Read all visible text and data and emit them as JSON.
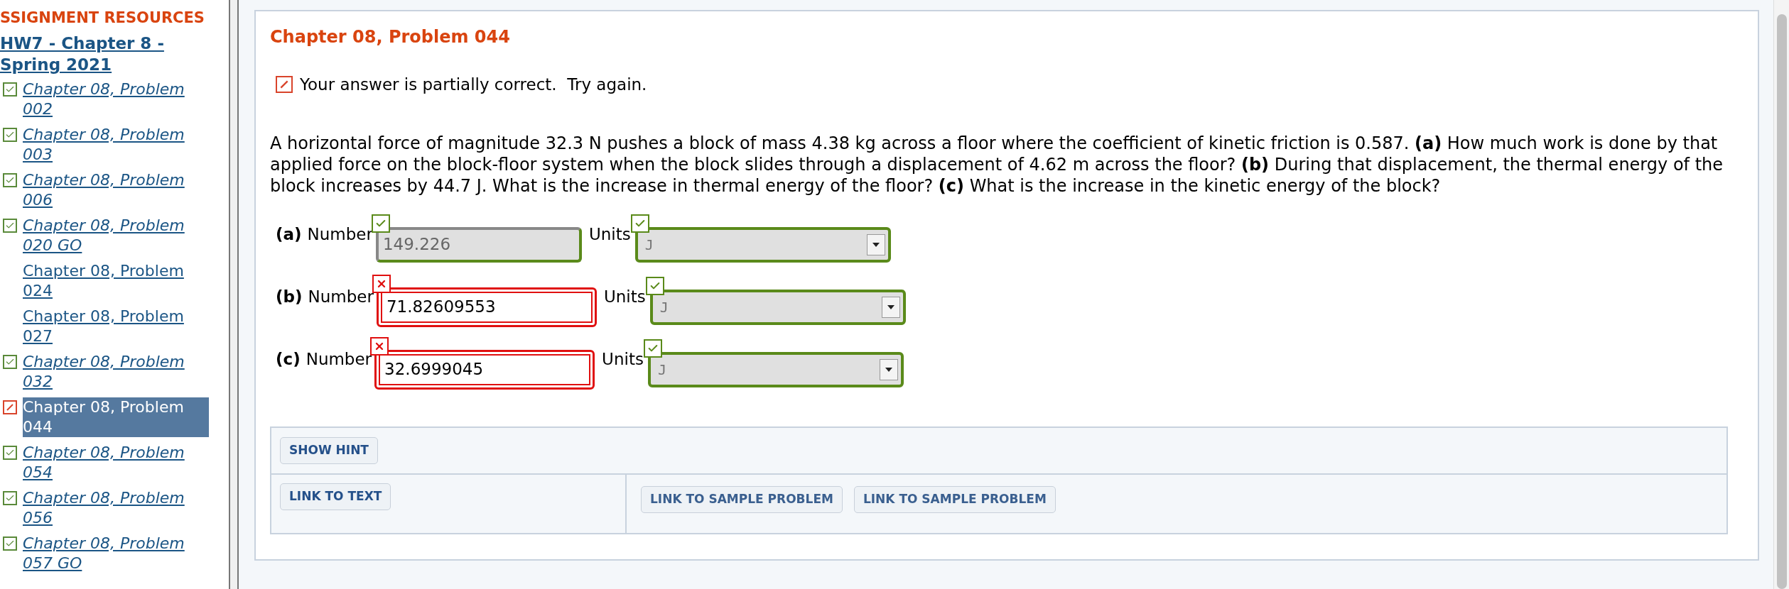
{
  "sidebar": {
    "heading": "SSIGNMENT RESOURCES",
    "assignment": "HW7 - Chapter 8 - Spring 2021",
    "items": [
      {
        "label": "Chapter 08, Problem 002",
        "kind": "correct",
        "selected": false
      },
      {
        "label": "Chapter 08, Problem 003",
        "kind": "correct",
        "selected": false
      },
      {
        "label": "Chapter 08, Problem 006",
        "kind": "correct",
        "selected": false
      },
      {
        "label": "Chapter 08, Problem 020 GO",
        "kind": "correct",
        "selected": false
      },
      {
        "label": "Chapter 08, Problem 024",
        "kind": "none",
        "selected": false
      },
      {
        "label": "Chapter 08, Problem 027",
        "kind": "none",
        "selected": false
      },
      {
        "label": "Chapter 08, Problem 032",
        "kind": "correct",
        "selected": false
      },
      {
        "label": "Chapter 08, Problem 044",
        "kind": "partial",
        "selected": true
      },
      {
        "label": "Chapter 08, Problem 054",
        "kind": "correct",
        "selected": false
      },
      {
        "label": "Chapter 08, Problem 056",
        "kind": "correct",
        "selected": false
      },
      {
        "label": "Chapter 08, Problem 057 GO",
        "kind": "correct",
        "selected": false
      }
    ]
  },
  "problem": {
    "title": "Chapter 08, Problem 044",
    "feedback": "Your answer is partially correct.  Try again.",
    "text": "A horizontal force of magnitude 32.3 N pushes a block of mass 4.38 kg across a floor where the coefficient of kinetic friction is 0.587. **(a)** How much work is done by that applied force on the block-floor system when the block slides through a displacement of 4.62 m across the floor? **(b)** During that displacement, the thermal energy of the block increases by 44.7 J. What is the increase in thermal energy of the floor? **(c)** What is the increase in the kinetic energy of the block?"
  },
  "answers": [
    {
      "part": "(a)",
      "label": "Number",
      "value": "149.226",
      "correct": true,
      "units_label": "Units",
      "units": "J",
      "units_correct": true
    },
    {
      "part": "(b)",
      "label": "Number",
      "value": "71.82609553",
      "correct": false,
      "units_label": "Units",
      "units": "J",
      "units_correct": true
    },
    {
      "part": "(c)",
      "label": "Number",
      "value": "32.6999045",
      "correct": false,
      "units_label": "Units",
      "units": "J",
      "units_correct": true
    }
  ],
  "hint_button": "SHOW HINT",
  "text_link": "LINK TO TEXT",
  "sample_links": [
    "LINK TO SAMPLE PROBLEM",
    "LINK TO SAMPLE PROBLEM"
  ]
}
